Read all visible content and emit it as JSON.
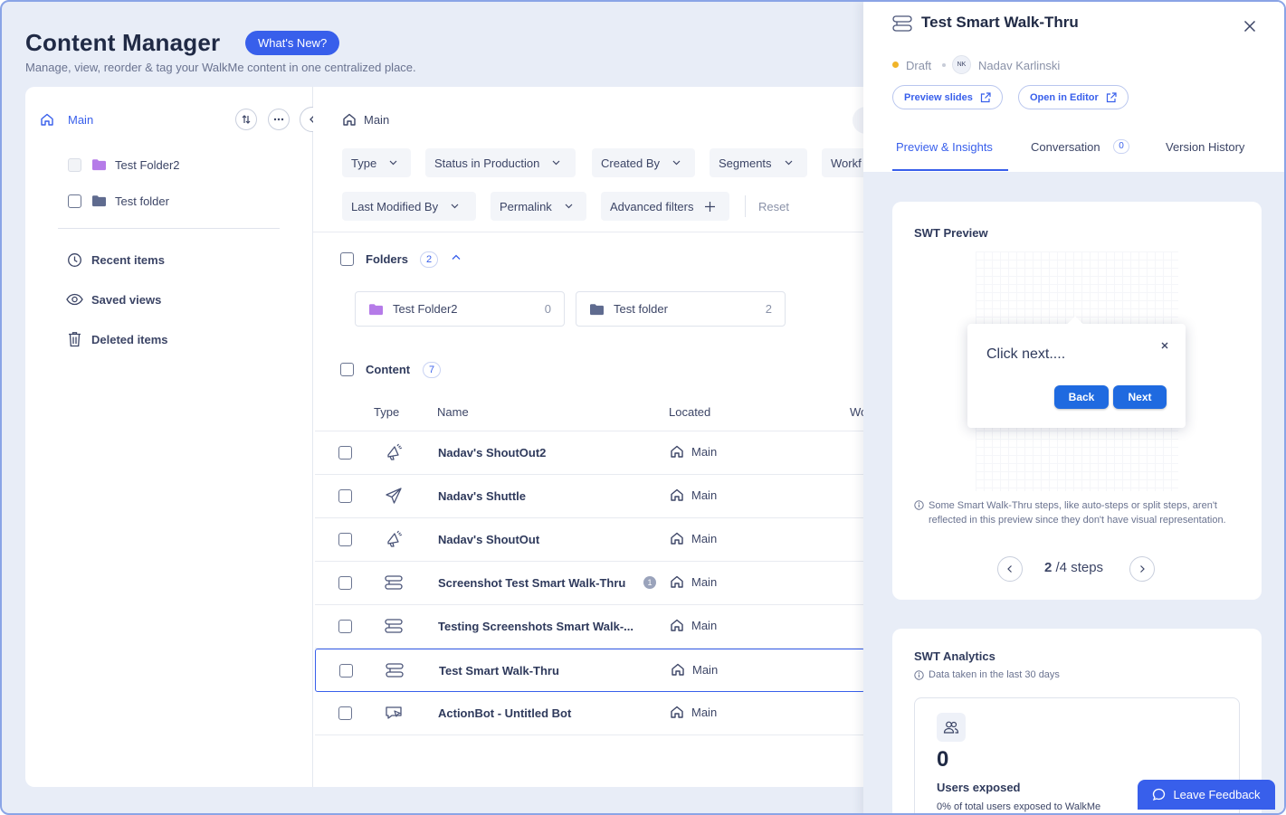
{
  "header": {
    "title": "Content Manager",
    "whats_new": "What's New?",
    "subtitle": "Manage, view, reorder & tag your WalkMe content in one centralized place."
  },
  "sidebar": {
    "root_label": "Main",
    "folders": [
      "Test Folder2",
      "Test folder"
    ],
    "nav": {
      "recent": "Recent items",
      "saved": "Saved views",
      "deleted": "Deleted items"
    }
  },
  "main": {
    "breadcrumb": "Main",
    "filters_row1": [
      "Type",
      "Status in Production",
      "Created By",
      "Segments",
      "Workf"
    ],
    "filters_row2": [
      "Last Modified By",
      "Permalink",
      "Advanced filters"
    ],
    "reset": "Reset",
    "folders_section": {
      "label": "Folders",
      "count": "2"
    },
    "folder_cards": [
      {
        "name": "Test Folder2",
        "count": "0"
      },
      {
        "name": "Test folder",
        "count": "2"
      }
    ],
    "content_section": {
      "label": "Content",
      "count": "7"
    },
    "columns": {
      "type": "Type",
      "name": "Name",
      "located": "Located",
      "wo": "Wo"
    },
    "rows": [
      {
        "icon": "shoutout-icon",
        "name": "Nadav's ShoutOut2",
        "located": "Main"
      },
      {
        "icon": "shuttle-icon",
        "name": "Nadav's Shuttle",
        "located": "Main"
      },
      {
        "icon": "shoutout-icon",
        "name": "Nadav's ShoutOut",
        "located": "Main"
      },
      {
        "icon": "smart-walkthru-icon",
        "name": "Screenshot Test Smart Walk-Thru",
        "located": "Main",
        "badge": "1"
      },
      {
        "icon": "smart-walkthru-icon",
        "name": "Testing Screenshots Smart Walk-...",
        "located": "Main"
      },
      {
        "icon": "smart-walkthru-icon",
        "name": "Test Smart Walk-Thru",
        "located": "Main",
        "selected": true
      },
      {
        "icon": "actionbot-icon",
        "name": "ActionBot - Untitled Bot",
        "located": "Main"
      }
    ]
  },
  "panel": {
    "title": "Test Smart Walk-Thru",
    "status": "Draft",
    "author_initials": "NK",
    "author": "Nadav Karlinski",
    "preview_slides": "Preview slides",
    "open_editor": "Open in Editor",
    "tabs": [
      "Preview & Insights",
      "Conversation",
      "Version History"
    ],
    "conversation_count": "0",
    "preview": {
      "title": "SWT Preview",
      "balloon_text": "Click next....",
      "back": "Back",
      "next": "Next",
      "note": "Some Smart Walk-Thru steps, like auto-steps or split steps, aren't reflected in this preview since they don't have visual representation.",
      "step_current": "2",
      "step_total": "/4 steps"
    },
    "analytics": {
      "title": "SWT Analytics",
      "note": "Data taken in the last 30 days",
      "value": "0",
      "label": "Users exposed",
      "sub": "0% of total users exposed to WalkMe"
    }
  },
  "feedback": "Leave Feedback",
  "colors": {
    "accent": "#385feb",
    "draft": "#f0b429",
    "folder_purple": "#b57be8",
    "folder_slate": "#5f6b8f"
  }
}
